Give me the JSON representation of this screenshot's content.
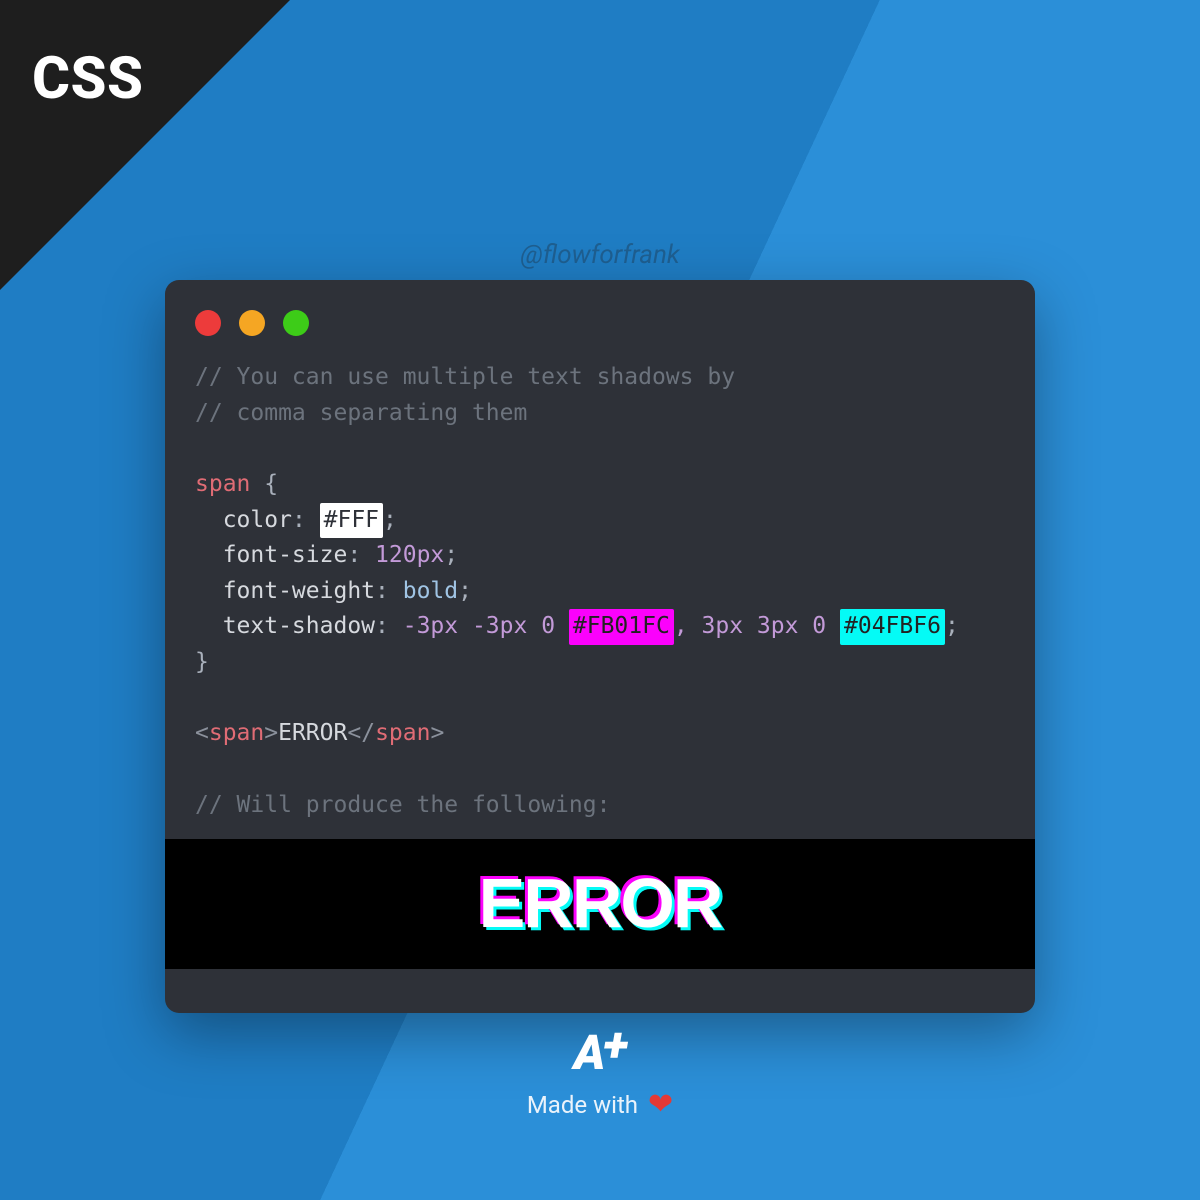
{
  "badge": {
    "label": "CSS"
  },
  "handle": "@flowforfrank",
  "code": {
    "comment1": "// You can use multiple text shadows by",
    "comment2": "// comma separating them",
    "selector": "span",
    "brace_open": " {",
    "prop_color": "  color",
    "colon": ": ",
    "val_color_hex": "#FFF",
    "semi": ";",
    "prop_fontsize": "  font-size",
    "val_fontsize": "120px",
    "prop_fontweight": "  font-weight",
    "val_fontweight": "bold",
    "prop_textshadow": "  text-shadow",
    "val_shadow_a": "-3px -3px 0 ",
    "val_shadow_hex1": "#FB01FC",
    "val_shadow_mid": ", 3px 3px 0 ",
    "val_shadow_hex2": "#04FBF6",
    "brace_close": "}",
    "tag_open_l": "<",
    "tag_name": "span",
    "tag_open_r": ">",
    "tag_text": "ERROR",
    "tag_close_l": "</",
    "tag_close_r": ">",
    "comment3": "// Will produce the following:"
  },
  "output": {
    "text": "ERROR"
  },
  "footer": {
    "logo_a": "A",
    "logo_plus": "+",
    "made": "Made with"
  },
  "colors": {
    "swatch_white_bg": "#FFFFFF",
    "swatch_white_fg": "#2e3138",
    "swatch_pink_bg": "#FB01FC",
    "swatch_pink_fg": "#2b2b2b",
    "swatch_cyan_bg": "#04FBF6",
    "swatch_cyan_fg": "#2b2b2b"
  }
}
